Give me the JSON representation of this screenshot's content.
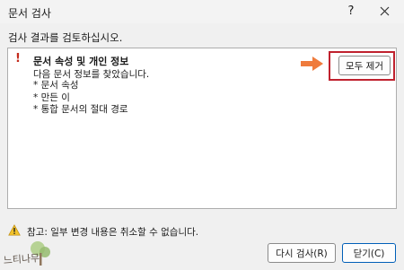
{
  "window": {
    "title": "문서 검사",
    "help_glyph": "?"
  },
  "instruction": "검사 결과를 검토하십시오.",
  "result": {
    "mark": "!",
    "title": "문서 속성 및 개인 정보",
    "description": "다음 문서 정보를 찾았습니다.",
    "items": [
      "* 문서 속성",
      "* 만든 이",
      "* 통합 문서의 절대 경로"
    ],
    "remove_all_label": "모두 제거"
  },
  "note": "참고: 일부 변경 내용은 취소할 수 없습니다.",
  "buttons": {
    "reinspect": "다시 검사(R)",
    "close": "닫기(C)"
  },
  "watermark_text": "느티나무",
  "colors": {
    "highlight": "#c0212e",
    "arrow": "#ef7b3c",
    "warning_mark": "#c42b1c",
    "focus": "#005fb8"
  },
  "icons": {
    "warning": "warning-triangle-icon",
    "close": "close-icon",
    "arrow": "arrow-right-icon"
  }
}
